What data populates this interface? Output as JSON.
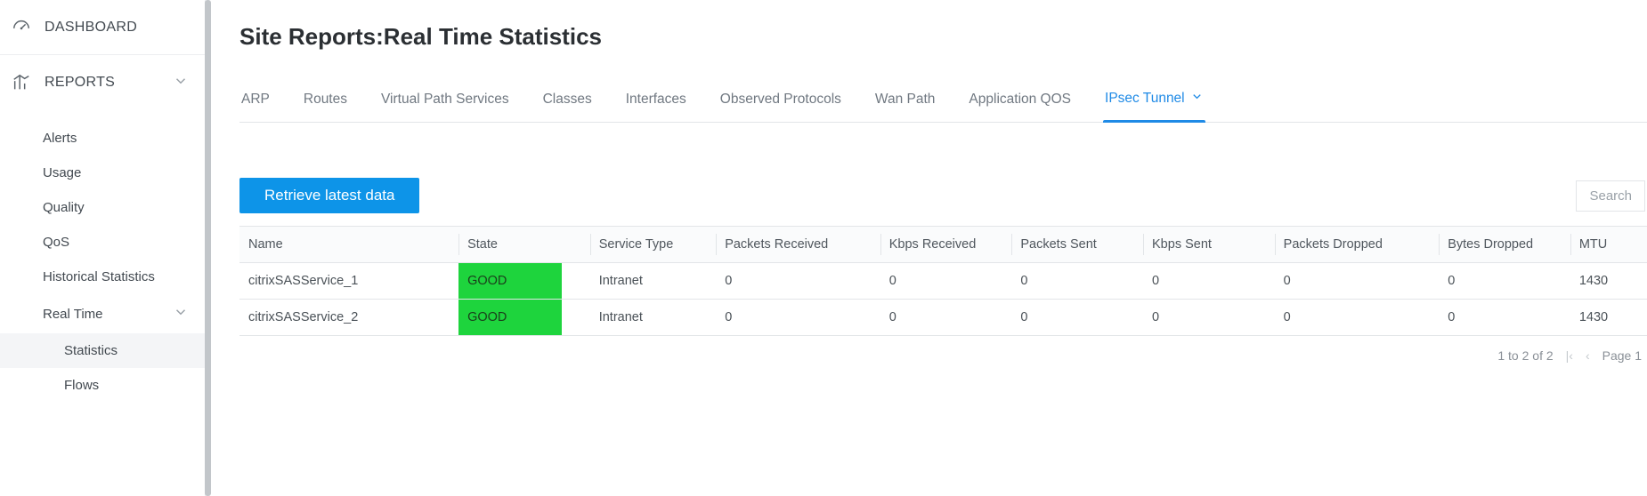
{
  "sidebar": {
    "dashboard_label": "DASHBOARD",
    "reports_label": "REPORTS",
    "items": [
      {
        "label": "Alerts"
      },
      {
        "label": "Usage"
      },
      {
        "label": "Quality"
      },
      {
        "label": "QoS"
      },
      {
        "label": "Historical Statistics"
      },
      {
        "label": "Real Time"
      }
    ],
    "realtime_children": [
      {
        "label": "Statistics"
      },
      {
        "label": "Flows"
      }
    ]
  },
  "page": {
    "title": "Site Reports:Real Time Statistics"
  },
  "tabs": [
    {
      "label": "ARP"
    },
    {
      "label": "Routes"
    },
    {
      "label": "Virtual Path Services"
    },
    {
      "label": "Classes"
    },
    {
      "label": "Interfaces"
    },
    {
      "label": "Observed Protocols"
    },
    {
      "label": "Wan Path"
    },
    {
      "label": "Application QOS"
    },
    {
      "label": "IPsec Tunnel"
    }
  ],
  "toolbar": {
    "retrieve_label": "Retrieve latest data",
    "search_placeholder": "Search"
  },
  "table": {
    "columns": [
      "Name",
      "State",
      "Service Type",
      "Packets Received",
      "Kbps Received",
      "Packets Sent",
      "Kbps Sent",
      "Packets Dropped",
      "Bytes Dropped",
      "MTU"
    ],
    "rows": [
      {
        "name": "citrixSASService_1",
        "state": "GOOD",
        "service_type": "Intranet",
        "packets_received": "0",
        "kbps_received": "0",
        "packets_sent": "0",
        "kbps_sent": "0",
        "packets_dropped": "0",
        "bytes_dropped": "0",
        "mtu": "1430"
      },
      {
        "name": "citrixSASService_2",
        "state": "GOOD",
        "service_type": "Intranet",
        "packets_received": "0",
        "kbps_received": "0",
        "packets_sent": "0",
        "kbps_sent": "0",
        "packets_dropped": "0",
        "bytes_dropped": "0",
        "mtu": "1430"
      }
    ]
  },
  "pager": {
    "range_text": "1 to 2 of 2",
    "page_text": "Page 1"
  }
}
